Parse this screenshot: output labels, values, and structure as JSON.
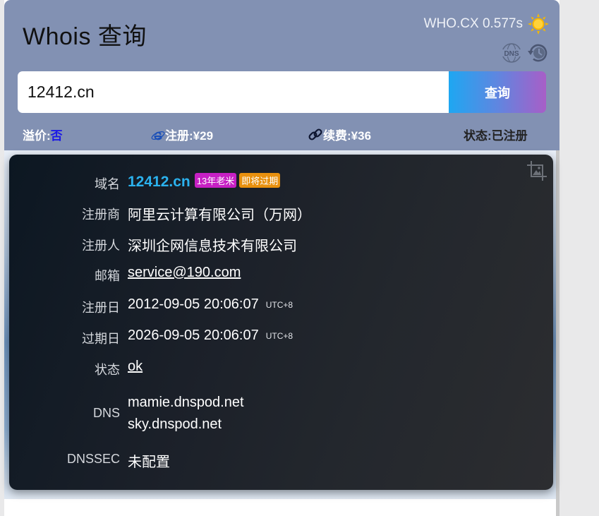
{
  "header": {
    "title": "Whois 查询",
    "brand": "WHO.CX 0.577s",
    "icons": [
      "sun-icon",
      "dns-icon",
      "clock-icon"
    ]
  },
  "search": {
    "value": "12412.cn",
    "button_label": "查询"
  },
  "info_bar": {
    "premium_label": "溢价:",
    "premium_value": "否",
    "register_label": "注册:",
    "register_value": "¥29",
    "renew_label": "续费:",
    "renew_value": "¥36",
    "status_label": "状态:",
    "status_value": "已注册"
  },
  "whois": {
    "domain": {
      "label": "域名",
      "value": "12412.cn",
      "badge_age": "13年老米",
      "badge_expiring": "即将过期"
    },
    "registrar": {
      "label": "注册商",
      "value": "阿里云计算有限公司（万网）"
    },
    "registrant": {
      "label": "注册人",
      "value": "深圳企网信息技术有限公司"
    },
    "email": {
      "label": "邮箱",
      "value": "service@190.com"
    },
    "created": {
      "label": "注册日",
      "value": "2012-09-05 20:06:07",
      "tz": "UTC+8"
    },
    "expires": {
      "label": "过期日",
      "value": "2026-09-05 20:06:07",
      "tz": "UTC+8"
    },
    "status": {
      "label": "状态",
      "value": "ok"
    },
    "dns": {
      "label": "DNS",
      "values": [
        "mamie.dnspod.net",
        "sky.dnspod.net"
      ]
    },
    "dnssec": {
      "label": "DNSSEC",
      "value": "未配置"
    }
  },
  "colors": {
    "header_bg": "#8291b3",
    "accent_blue": "#2bb2ee",
    "badge_age": "#c720c4",
    "badge_expiring": "#e8900e"
  }
}
